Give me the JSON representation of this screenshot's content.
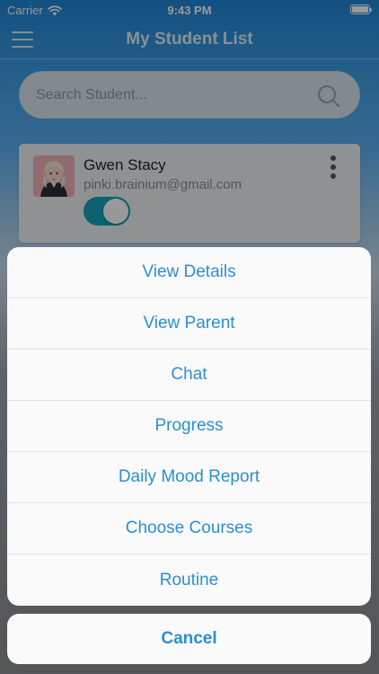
{
  "status_bar": {
    "carrier": "Carrier",
    "time": "9:43 PM"
  },
  "nav": {
    "title": "My Student List"
  },
  "search": {
    "placeholder": "Search Student..."
  },
  "student": {
    "name": "Gwen Stacy",
    "email": "pinki.brainium@gmail.com",
    "active": true
  },
  "action_sheet": {
    "items": [
      {
        "label": "View Details"
      },
      {
        "label": "View Parent"
      },
      {
        "label": "Chat"
      },
      {
        "label": "Progress"
      },
      {
        "label": "Daily Mood Report"
      },
      {
        "label": "Choose Courses"
      },
      {
        "label": "Routine"
      }
    ],
    "cancel_label": "Cancel"
  },
  "colors": {
    "accent": "#2b8fd1",
    "toggle_on": "#14a3b8",
    "nav": "#1f86d6"
  }
}
